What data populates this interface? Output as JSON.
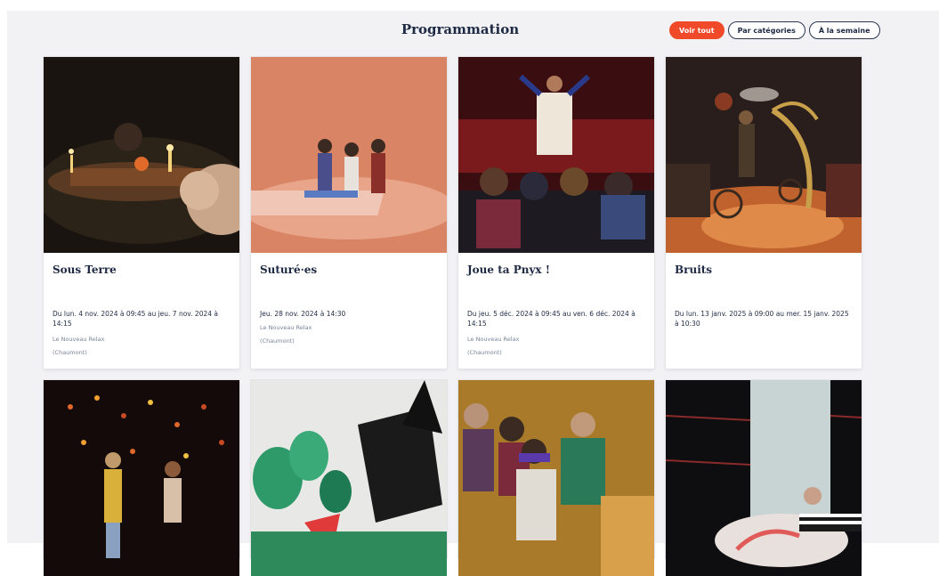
{
  "header": {
    "title": "Programmation",
    "filters": [
      "Voir tout",
      "Par catégories",
      "À la semaine"
    ]
  },
  "events": [
    {
      "title": "Sous Terre",
      "date": "Du lun. 4 nov. 2024 à 09:45 au jeu. 7 nov. 2024 à 14:15",
      "venue": "Le Nouveau Relax",
      "city": "(Chaumont)"
    },
    {
      "title": "Suturé·es",
      "date": "Jeu. 28 nov. 2024 à 14:30",
      "venue": "Le Nouveau Relax",
      "city": "(Chaumont)"
    },
    {
      "title": "Joue ta Pnyx !",
      "date": "Du jeu. 5 déc. 2024 à 09:45 au ven. 6 déc. 2024 à 14:15",
      "venue": "Le Nouveau Relax",
      "city": "(Chaumont)"
    },
    {
      "title": "Bruits",
      "date": "Du lun. 13 janv. 2025 à 09:00 au mer. 15 janv. 2025 à 10:30",
      "venue": "",
      "city": ""
    }
  ],
  "colors": {
    "accent": "#f04a2a",
    "navy": "#1e2a44",
    "background": "#f2f2f5"
  }
}
